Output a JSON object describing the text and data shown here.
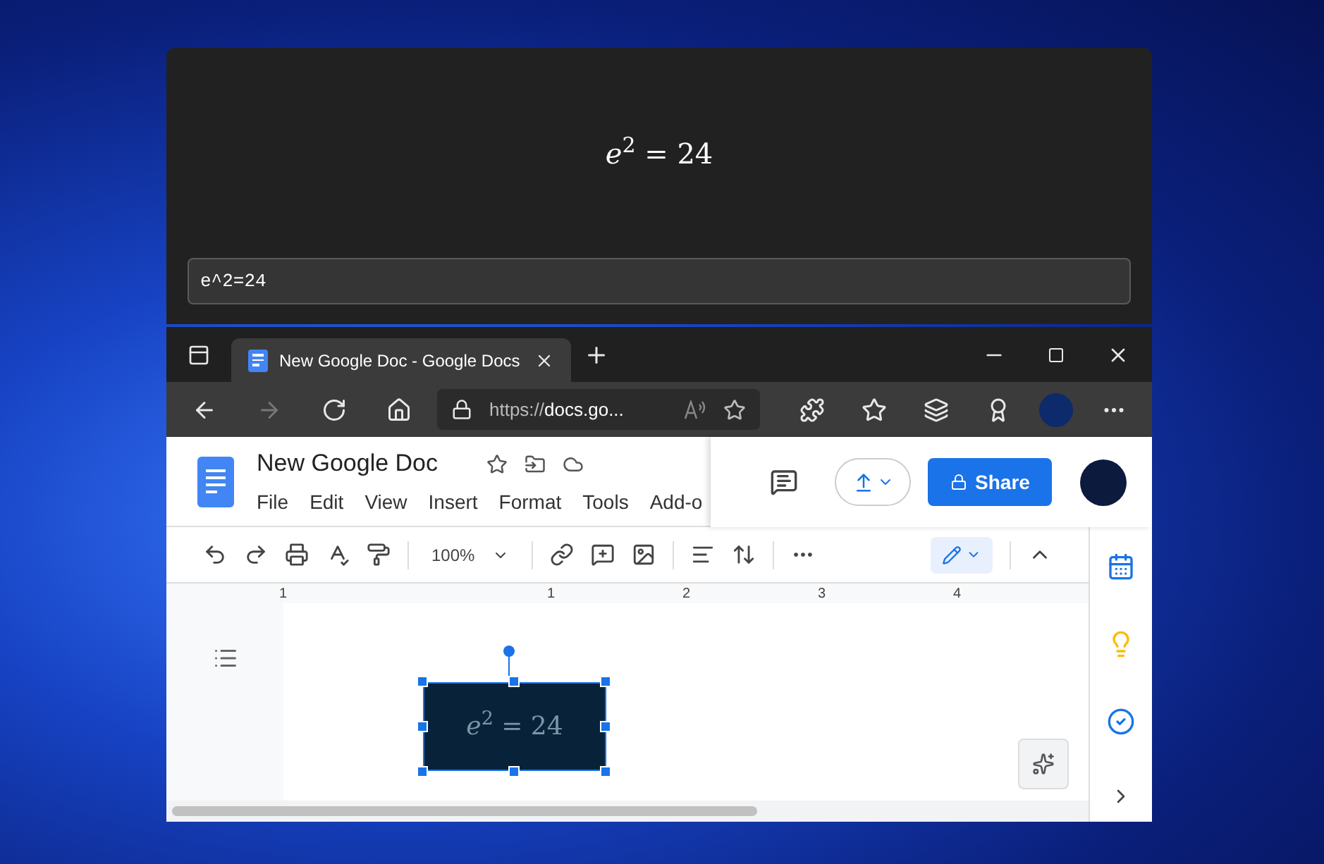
{
  "equation_window": {
    "rendered": "*e*$^{2}$ = 24",
    "input": "e^2=24"
  },
  "browser": {
    "tab_title": "New Google Doc - Google Docs",
    "address": "https://**docs.go...**"
  },
  "docs": {
    "title": "New Google Doc",
    "menu": [
      "File",
      "Edit",
      "View",
      "Insert",
      "Format",
      "Tools",
      "Add-o"
    ],
    "share": "Share",
    "zoom": "100%",
    "ruler": [
      "1",
      "1",
      "2",
      "3",
      "4"
    ],
    "drawing_equation": "*e*$^{2}$ = 24"
  }
}
